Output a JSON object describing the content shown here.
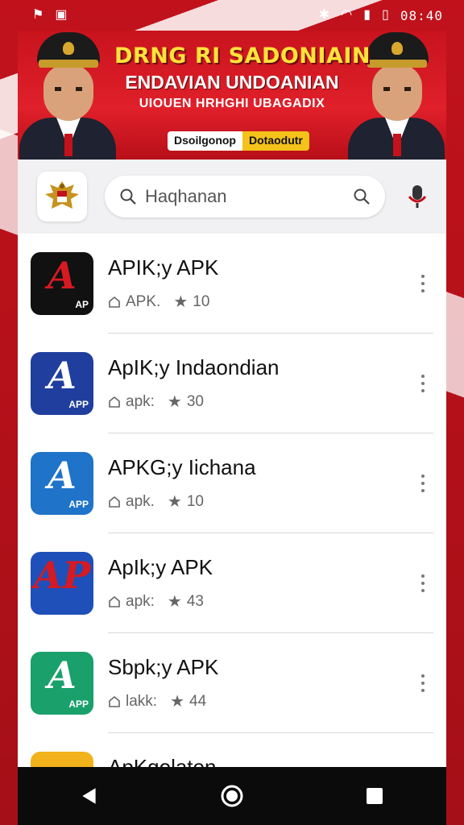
{
  "status_bar": {
    "time": "08:40",
    "left_icons": [
      "notification-flag-icon",
      "screenshot-icon"
    ],
    "right_icons": [
      "bluetooth-icon",
      "wifi-icon",
      "signal-icon",
      "battery-icon"
    ]
  },
  "banner": {
    "title": "DRNG RI SADONIAIN",
    "subtitle_1": "ENDAVIAN UNDOANIAN",
    "subtitle_2": "UIOUEN HRHGHI UBAGADIX",
    "pill_left": "Dsoilgonop",
    "pill_right": "Dotaodutr"
  },
  "search": {
    "placeholder": "Haqhanan",
    "icons": [
      "garuda-emblem-icon",
      "search-icon",
      "search-action-icon",
      "microphone-icon"
    ]
  },
  "apps": [
    {
      "name": "APIK;y APK",
      "meta_label": "APK.",
      "rating": "10",
      "icon_color": "#111111",
      "icon_accent": "#d61a22",
      "glyph": "A",
      "tag": "AP"
    },
    {
      "name": "ApIK;y Indaondian",
      "meta_label": "apk:",
      "rating": "30",
      "icon_color": "#1f3e9e",
      "icon_accent": "#ffffff",
      "glyph": "A",
      "tag": "APP"
    },
    {
      "name": "APKG;y Iichana",
      "meta_label": "apk.",
      "rating": "10",
      "icon_color": "#1f73c8",
      "icon_accent": "#ffffff",
      "glyph": "A",
      "tag": "APP"
    },
    {
      "name": "ApIk;y APK",
      "meta_label": "apk:",
      "rating": "43",
      "icon_color": "#1f4fb8",
      "icon_accent": "#d61a22",
      "glyph": "AP",
      "tag": ""
    },
    {
      "name": "Sbpk;y APK",
      "meta_label": "lakk:",
      "rating": "44",
      "icon_color": "#19a06b",
      "icon_accent": "#ffffff",
      "glyph": "A",
      "tag": "APP"
    },
    {
      "name": "ApKqolaten",
      "meta_label": "",
      "rating": "",
      "icon_color": "#f2b21b",
      "icon_accent": "#222222",
      "glyph": "",
      "tag": ""
    }
  ],
  "nav": {
    "buttons": [
      "back-icon",
      "home-icon",
      "recents-icon"
    ]
  },
  "colors": {
    "brand_red": "#c1121c",
    "banner_title": "#ffe23a",
    "panel_bg": "#ffffff",
    "nav_bg": "#0b0b0b"
  }
}
